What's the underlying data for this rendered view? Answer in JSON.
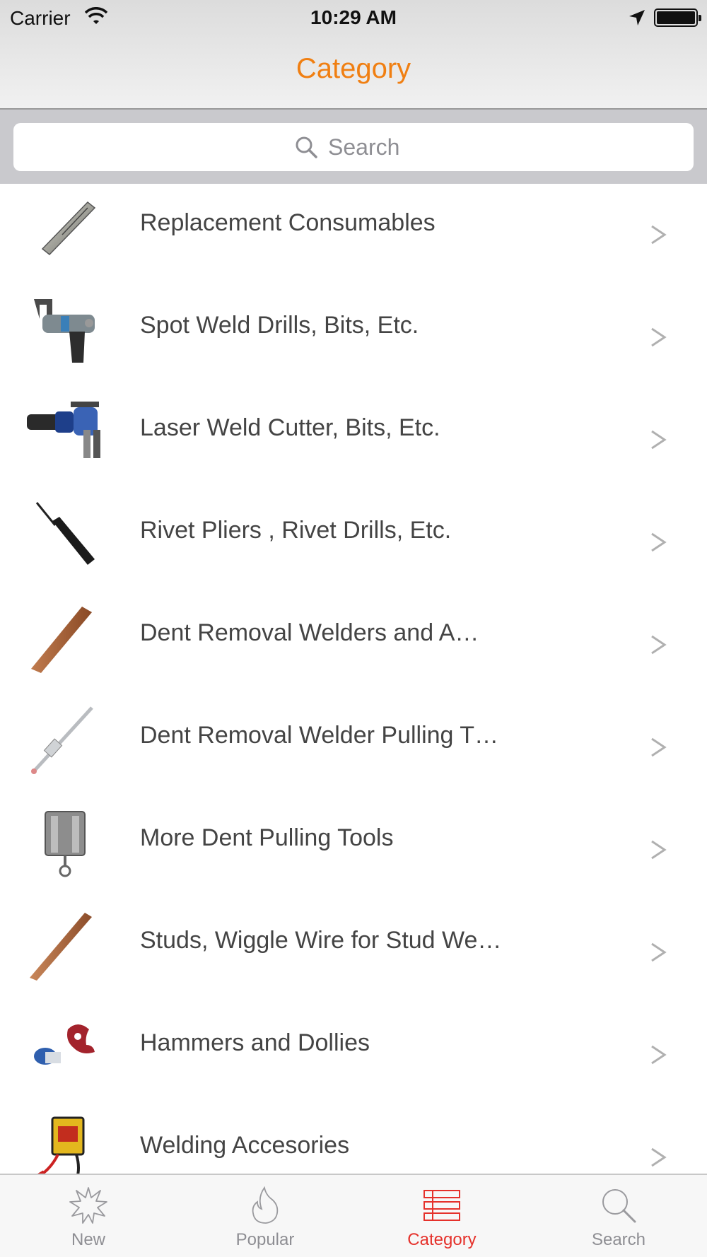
{
  "status_bar": {
    "carrier": "Carrier",
    "time": "10:29 AM"
  },
  "nav": {
    "title": "Category"
  },
  "search": {
    "placeholder": "Search"
  },
  "categories": [
    {
      "label": "Replacement Consumables",
      "icon": "drill-bit-thumbnail"
    },
    {
      "label": "Spot Weld Drills, Bits, Etc.",
      "icon": "spot-weld-drill-thumbnail"
    },
    {
      "label": "Laser Weld Cutter, Bits, Etc.",
      "icon": "laser-weld-cutter-thumbnail"
    },
    {
      "label": "Rivet Pliers , Rivet Drills, Etc.",
      "icon": "rivet-drill-thumbnail"
    },
    {
      "label": "Dent Removal Welders and A…",
      "icon": "copper-rod-thumbnail"
    },
    {
      "label": "Dent Removal Welder Pulling T…",
      "icon": "pulling-rod-thumbnail"
    },
    {
      "label": "More Dent Pulling Tools",
      "icon": "pulling-tool-thumbnail"
    },
    {
      "label": "Studs, Wiggle Wire for Stud We…",
      "icon": "copper-stud-thumbnail"
    },
    {
      "label": "Hammers and Dollies",
      "icon": "hammer-dolly-thumbnail"
    },
    {
      "label": "Welding Accesories",
      "icon": "welding-accessory-thumbnail"
    }
  ],
  "tabs": [
    {
      "label": "New",
      "icon": "star-burst-icon",
      "active": false
    },
    {
      "label": "Popular",
      "icon": "flame-icon",
      "active": false
    },
    {
      "label": "Category",
      "icon": "list-icon",
      "active": true
    },
    {
      "label": "Search",
      "icon": "magnifier-icon",
      "active": false
    }
  ],
  "colors": {
    "accent": "#f07f12",
    "active_tab": "#e5312b",
    "inactive_tab": "#8e8e93"
  }
}
